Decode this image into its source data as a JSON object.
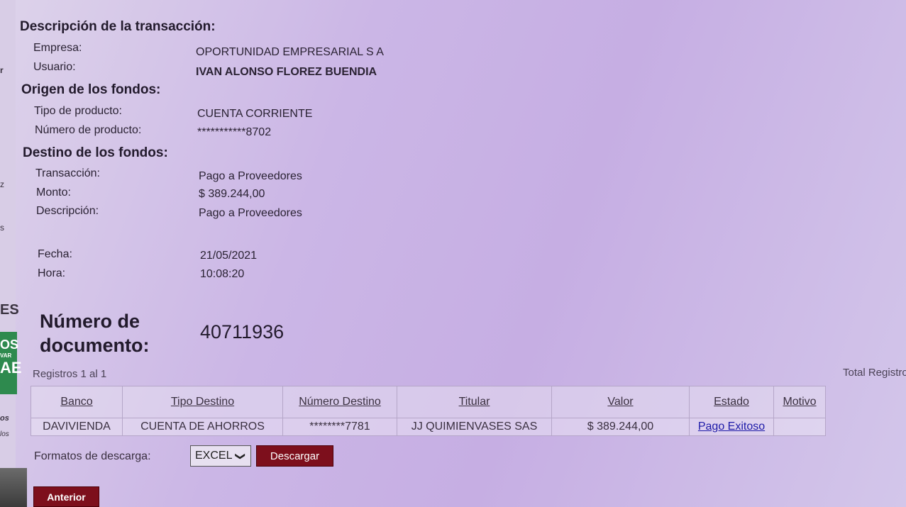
{
  "left_fragments": [
    "r",
    "z",
    "s",
    "ES",
    "OS",
    "VAR",
    "AE",
    "os",
    "los"
  ],
  "transaccion": {
    "title": "Descripción de la transacción:",
    "empresa_label": "Empresa:",
    "empresa_value": "OPORTUNIDAD EMPRESARIAL S A",
    "usuario_label": "Usuario:",
    "usuario_value": "IVAN ALONSO FLOREZ BUENDIA"
  },
  "origen": {
    "title": "Origen de los fondos:",
    "tipo_label": "Tipo de producto:",
    "tipo_value": "CUENTA CORRIENTE",
    "numero_label": "Número de producto:",
    "numero_value": "***********8702"
  },
  "destino": {
    "title": "Destino de los fondos:",
    "transaccion_label": "Transacción:",
    "transaccion_value": "Pago a Proveedores",
    "monto_label": "Monto:",
    "monto_value": "$ 389.244,00",
    "descripcion_label": "Descripción:",
    "descripcion_value": "Pago a Proveedores"
  },
  "fecha": {
    "label": "Fecha:",
    "value": "21/05/2021"
  },
  "hora": {
    "label": "Hora:",
    "value": "10:08:20"
  },
  "documento": {
    "label": "Número de documento:",
    "value": "40711936"
  },
  "registros": "Registros 1  al 1",
  "total_registros": "Total Registro",
  "table": {
    "headers": [
      "Banco",
      "Tipo Destino",
      "Número Destino",
      "Titular",
      "Valor",
      "Estado",
      "Motivo"
    ],
    "rows": [
      [
        "DAVIVIENDA",
        "CUENTA DE AHORROS",
        "********7781",
        "JJ QUIMIENVASES SAS",
        "$ 389.244,00",
        "Pago Exitoso",
        ""
      ]
    ]
  },
  "descarga": {
    "label": "Formatos de descarga:",
    "selected": "EXCEL",
    "button": "Descargar"
  },
  "anterior_button": "Anterior",
  "colors": {
    "button_bg": "#7d0f1c",
    "link": "#1d1aa8",
    "accent_green": "#2e8a4e"
  }
}
